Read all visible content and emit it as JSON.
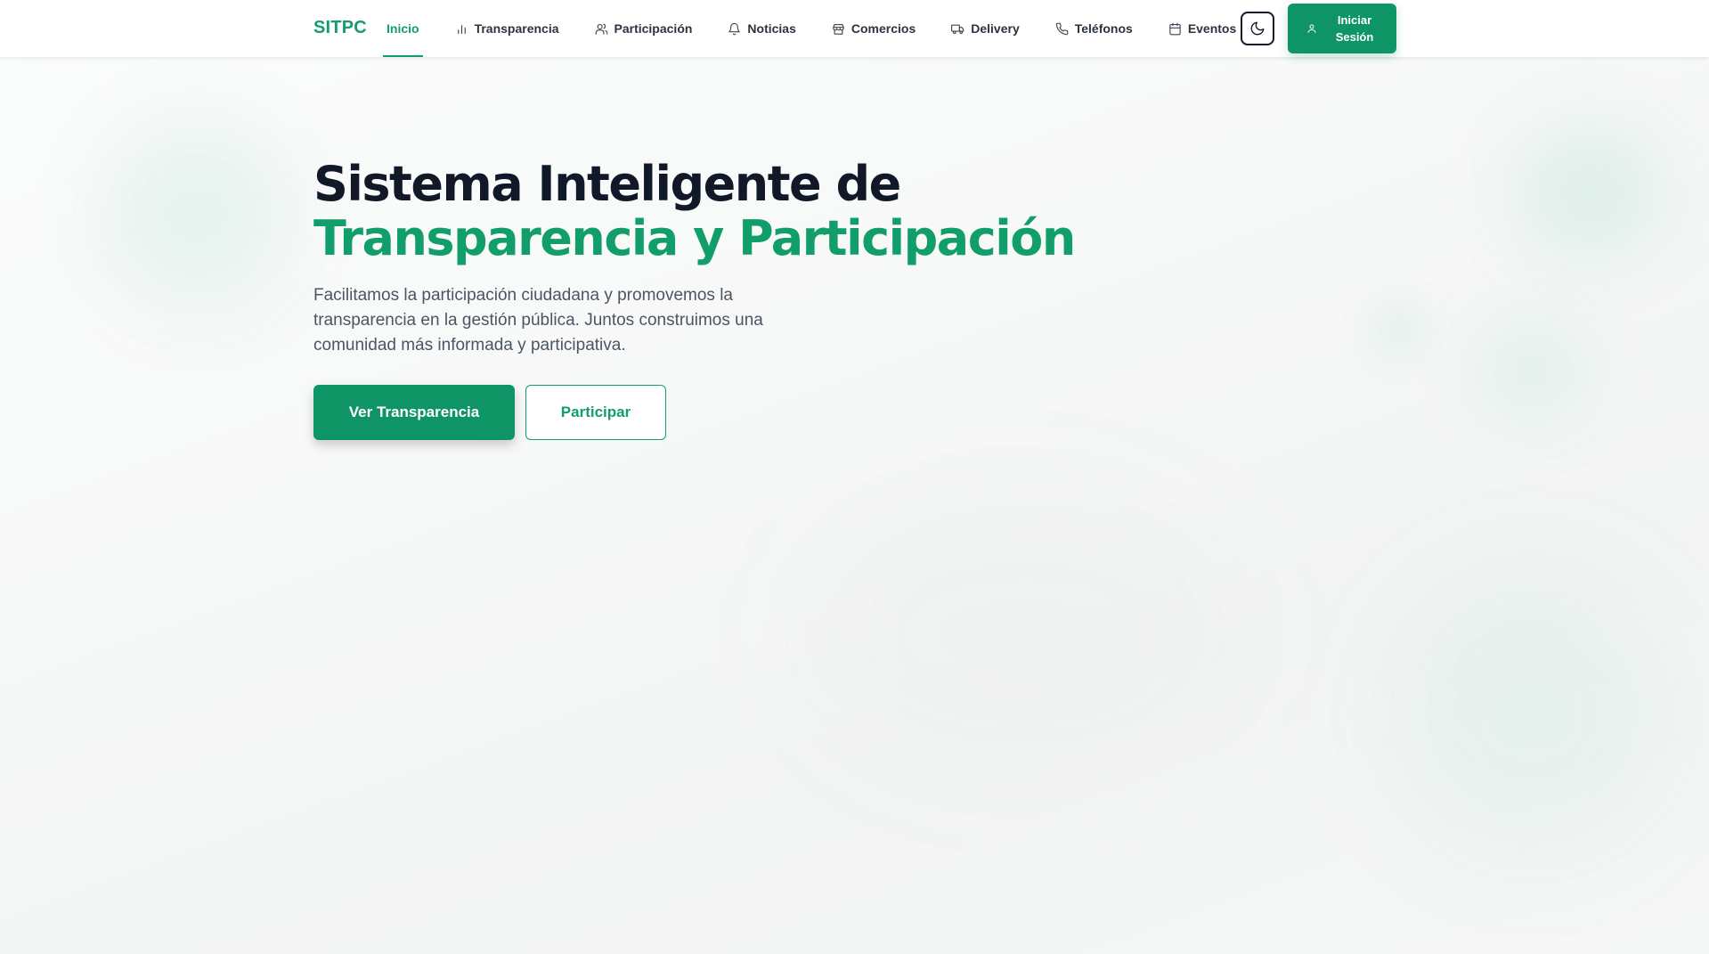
{
  "brand": "SITPC",
  "nav": {
    "items": [
      {
        "label": "Inicio",
        "icon": "none",
        "active": true
      },
      {
        "label": "Transparencia",
        "icon": "bar-chart-icon"
      },
      {
        "label": "Participación",
        "icon": "users-icon"
      },
      {
        "label": "Noticias",
        "icon": "bell-icon"
      },
      {
        "label": "Comercios",
        "icon": "store-icon"
      },
      {
        "label": "Delivery",
        "icon": "truck-icon"
      },
      {
        "label": "Teléfonos",
        "icon": "phone-icon"
      },
      {
        "label": "Eventos",
        "icon": "calendar-icon"
      }
    ],
    "theme_toggle_icon": "moon-icon",
    "login_label": "Iniciar\nSesión"
  },
  "hero": {
    "title_line1": "Sistema Inteligente de",
    "title_line2": "Transparencia y Participación",
    "description": "Facilitamos la participación ciudadana y promovemos la transparencia en la gestión pública. Juntos construimos una comunidad más informada y participativa.",
    "primary_button": "Ver Transparencia",
    "secondary_button": "Participar"
  },
  "colors": {
    "accent": "#129e6a",
    "button": "#0f9466",
    "heading": "#111827",
    "text": "#4b5563"
  }
}
